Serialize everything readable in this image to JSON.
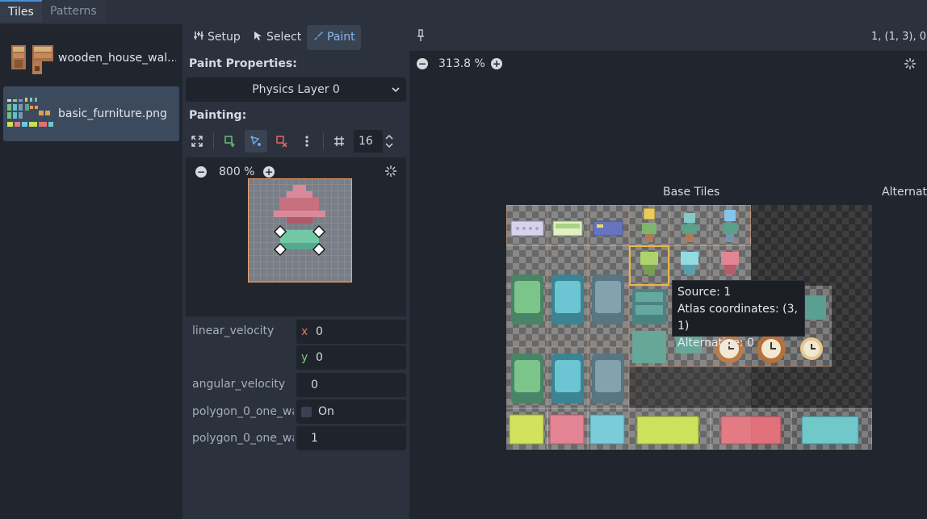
{
  "tabs": [
    {
      "label": "Tiles",
      "active": true
    },
    {
      "label": "Patterns",
      "active": false
    }
  ],
  "sources": [
    {
      "name": "wooden_house_wal...",
      "selected": false
    },
    {
      "name": "basic_furniture.png",
      "selected": true
    }
  ],
  "modes": [
    {
      "label": "Setup",
      "icon": "setup-icon",
      "active": false
    },
    {
      "label": "Select",
      "icon": "cursor-icon",
      "active": false
    },
    {
      "label": "Paint",
      "icon": "brush-icon",
      "active": true
    }
  ],
  "paint_properties": {
    "title": "Paint Properties:",
    "layer": "Physics Layer 0"
  },
  "painting": {
    "title": "Painting:",
    "snap_value": "16"
  },
  "preview": {
    "zoom": "800 %"
  },
  "properties": {
    "linear_velocity": {
      "label": "linear_velocity",
      "x": "0",
      "y": "0"
    },
    "angular_velocity": {
      "label": "angular_velocity",
      "value": "0"
    },
    "one_way": {
      "label": "polygon_0_one_wa",
      "checkbox_label": "On",
      "checked": false
    },
    "one_way_margin": {
      "label": "polygon_0_one_wa",
      "value": "1"
    }
  },
  "atlas": {
    "coords": "1, (1, 3), 0",
    "zoom": "313.8 %",
    "base_tiles_label": "Base Tiles",
    "alternative_label": "Alternat"
  },
  "tooltip": {
    "source": "Source: 1",
    "atlas_coords": "Atlas coordinates: (3, 1)",
    "alternative": "Alternative: 0"
  },
  "colors": {
    "accent": "#4a8fd8",
    "panel_bg": "#2b313d",
    "dark_bg": "#21262e",
    "x_axis": "#d47a6a",
    "y_axis": "#7ec77a",
    "selection": "#e8b84a"
  }
}
